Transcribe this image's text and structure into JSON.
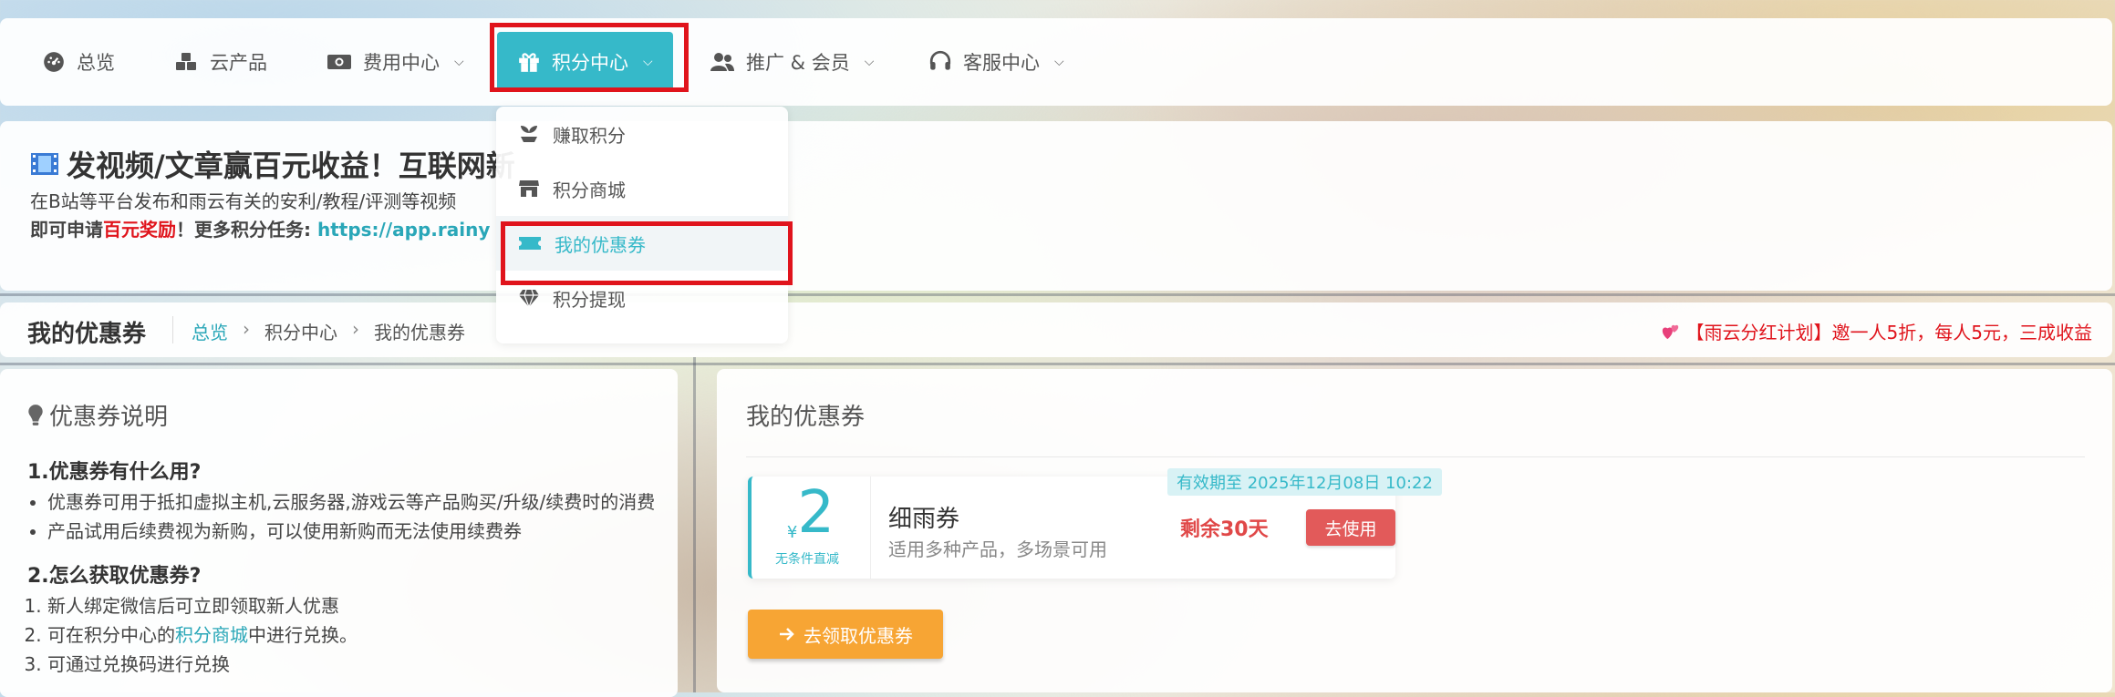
{
  "nav": {
    "overview": "总览",
    "cloud_products": "云产品",
    "billing": "费用中心",
    "points": "积分中心",
    "promotion": "推广 & 会员",
    "support": "客服中心"
  },
  "dropdown": {
    "earn": "赚取积分",
    "shop": "积分商城",
    "coupons": "我的优惠券",
    "withdraw": "积分提现"
  },
  "banner": {
    "title": "发视频/文章赢百元收益！互联网新",
    "line2": "在B站等平台发布和雨云有关的安利/教程/评测等视频",
    "line3_prefix": "即可申请",
    "line3_highlight": "百元奖励",
    "line3_middle": "！更多积分任务: ",
    "line3_link": "https://app.rainy"
  },
  "breadcrumb": {
    "page_title": "我的优惠券",
    "home": "总览",
    "level1": "积分中心",
    "current": "我的优惠券",
    "separator": "›"
  },
  "promo": "【雨云分红计划】邀一人5折，每人5元，三成收益",
  "left_panel": {
    "title": "优惠券说明",
    "q1": "1.优惠券有什么用?",
    "q1_items": [
      "优惠券可用于抵扣虚拟主机,云服务器,游戏云等产品购买/升级/续费时的消费",
      "产品试用后续费视为新购，可以使用新购而无法使用续费券"
    ],
    "q2": "2.怎么获取优惠券?",
    "q2_item1": "新人绑定微信后可立即领取新人优惠",
    "q2_item2_prefix": "可在积分中心的",
    "q2_item2_link": "积分商城",
    "q2_item2_suffix": "中进行兑换。",
    "q2_item3": "可通过兑换码进行兑换"
  },
  "right_panel": {
    "title": "我的优惠券",
    "coupon": {
      "currency": "¥",
      "amount": "2",
      "condition": "无条件直减",
      "name": "细雨券",
      "desc": "适用多种产品，多场景可用",
      "expire": "有效期至 2025年12月08日 10:22",
      "remaining": "剩余30天",
      "use_label": "去使用"
    },
    "get_coupon_label": "去领取优惠券"
  },
  "colors": {
    "accent": "#36b9c9",
    "danger": "#e0141c",
    "orange": "#f7a534"
  }
}
